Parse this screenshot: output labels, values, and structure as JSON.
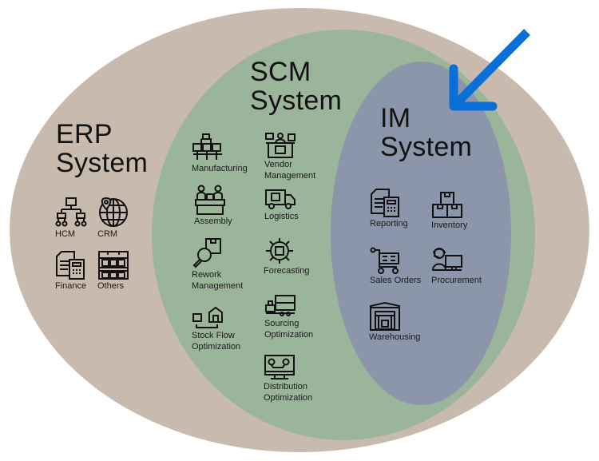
{
  "colors": {
    "erp": "#c8bbad",
    "scm": "#9bb59b",
    "im": "#8b96ab",
    "arrow": "#0a6fd8",
    "background": "#ffffff"
  },
  "erp": {
    "title_line1": "ERP",
    "title_line2": "System",
    "items": [
      {
        "label": "HCM",
        "icon": "org-chart-icon"
      },
      {
        "label": "CRM",
        "icon": "globe-pin-icon"
      },
      {
        "label": "Finance",
        "icon": "document-calculator-icon"
      },
      {
        "label": "Others",
        "icon": "shelves-boxes-icon"
      }
    ]
  },
  "scm": {
    "title_line1": "SCM",
    "title_line2": "System",
    "items": [
      {
        "label": "Manufacturing",
        "icon": "factory-boxes-icon"
      },
      {
        "label": "Vendor\nManagement",
        "icon": "vendor-counter-icon"
      },
      {
        "label": "Assembly",
        "icon": "assembly-line-icon"
      },
      {
        "label": "Logistics",
        "icon": "delivery-truck-icon"
      },
      {
        "label": "Rework\nManagement",
        "icon": "magnifier-box-icon"
      },
      {
        "label": "Forecasting",
        "icon": "box-network-icon"
      },
      {
        "label": "Stock Flow\nOptimization",
        "icon": "box-to-warehouse-icon"
      },
      {
        "label": "Sourcing\nOptimization",
        "icon": "boxes-truck-icon"
      },
      {
        "label": "Distribution\nOptimization",
        "icon": "monitor-route-icon"
      }
    ]
  },
  "im": {
    "title_line1": "IM",
    "title_line2": "System",
    "items": [
      {
        "label": "Reporting",
        "icon": "document-calculator-icon"
      },
      {
        "label": "Inventory",
        "icon": "stacked-boxes-icon"
      },
      {
        "label": "Sales Orders",
        "icon": "shopping-cart-icon"
      },
      {
        "label": "Procurement",
        "icon": "agent-computer-icon"
      },
      {
        "label": "Warehousing",
        "icon": "warehouse-icon"
      }
    ]
  },
  "arrow": {
    "icon": "arrow-down-left-icon",
    "points_to": "IM System"
  }
}
